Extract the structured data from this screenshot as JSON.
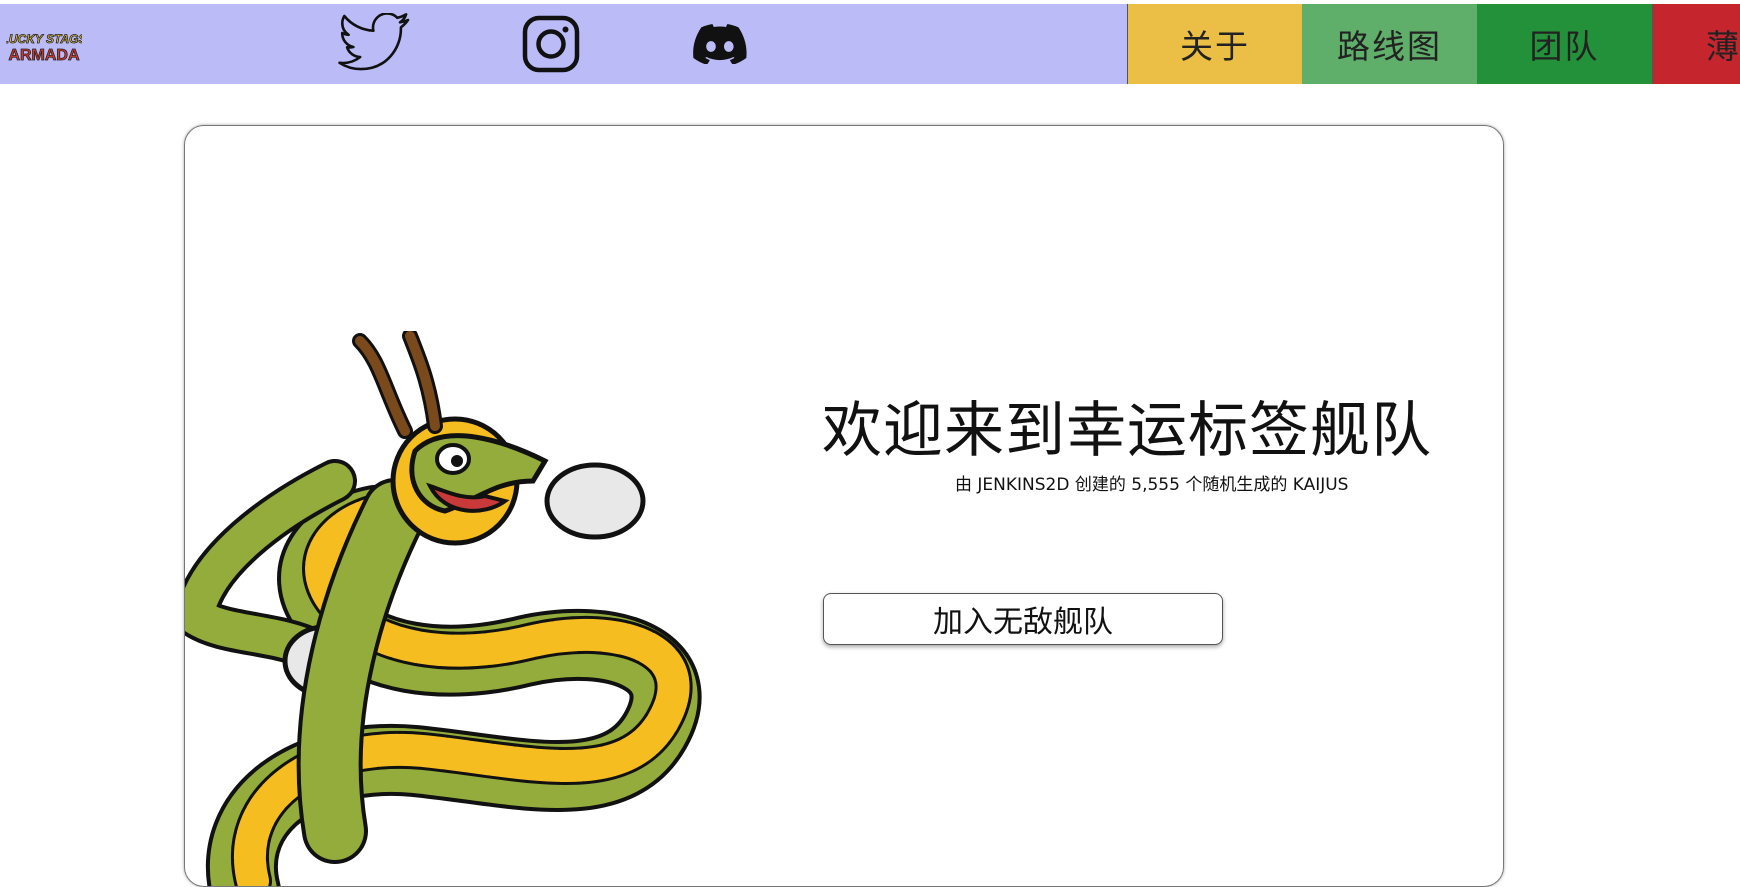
{
  "header": {
    "logo_text_top": "LUCKY STAGS",
    "logo_text_bottom": "ARMADA",
    "social": [
      {
        "name": "twitter",
        "icon": "twitter-icon"
      },
      {
        "name": "instagram",
        "icon": "instagram-icon"
      },
      {
        "name": "discord",
        "icon": "discord-icon"
      }
    ],
    "nav": [
      {
        "label": "关于",
        "color": "#ebbf45"
      },
      {
        "label": "路线图",
        "color": "#5fae69"
      },
      {
        "label": "团队",
        "color": "#229139"
      },
      {
        "label": "薄",
        "color": "#c5262e"
      }
    ],
    "background": "#bbbbf8"
  },
  "hero": {
    "title": "欢迎来到幸运标签舰队",
    "subtitle": "由 JENKINS2D 创建的 5,555 个随机生成的 KAIJUS",
    "join_button": "加入无敌舰队",
    "illustration": "dragon-illustration"
  }
}
